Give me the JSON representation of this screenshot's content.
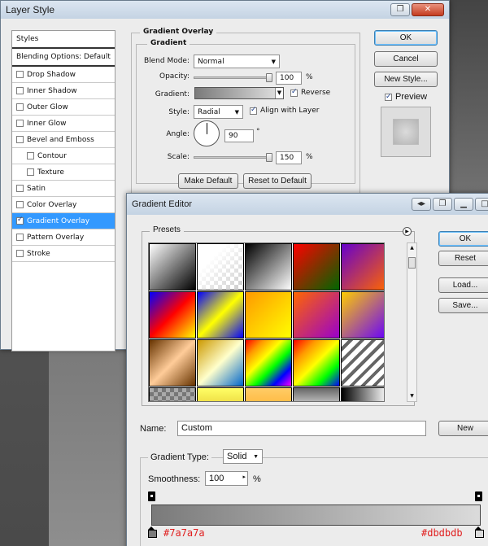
{
  "layer_style": {
    "title": "Layer Style",
    "styles_header": "Styles",
    "blending_options": "Blending Options: Default",
    "items": [
      {
        "label": "Drop Shadow",
        "checked": false,
        "sub": false,
        "active": false
      },
      {
        "label": "Inner Shadow",
        "checked": false,
        "sub": false,
        "active": false
      },
      {
        "label": "Outer Glow",
        "checked": false,
        "sub": false,
        "active": false
      },
      {
        "label": "Inner Glow",
        "checked": false,
        "sub": false,
        "active": false
      },
      {
        "label": "Bevel and Emboss",
        "checked": false,
        "sub": false,
        "active": false
      },
      {
        "label": "Contour",
        "checked": false,
        "sub": true,
        "active": false
      },
      {
        "label": "Texture",
        "checked": false,
        "sub": true,
        "active": false
      },
      {
        "label": "Satin",
        "checked": false,
        "sub": false,
        "active": false
      },
      {
        "label": "Color Overlay",
        "checked": false,
        "sub": false,
        "active": false
      },
      {
        "label": "Gradient Overlay",
        "checked": true,
        "sub": false,
        "active": true
      },
      {
        "label": "Pattern Overlay",
        "checked": false,
        "sub": false,
        "active": false
      },
      {
        "label": "Stroke",
        "checked": false,
        "sub": false,
        "active": false
      }
    ],
    "section_title": "Gradient Overlay",
    "group_title": "Gradient",
    "blend_mode_label": "Blend Mode:",
    "blend_mode_value": "Normal",
    "opacity_label": "Opacity:",
    "opacity_value": "100",
    "opacity_unit": "%",
    "opacity_level": 1.0,
    "gradient_label": "Gradient:",
    "reverse_label": "Reverse",
    "reverse_checked": true,
    "style_label": "Style:",
    "style_value": "Radial",
    "align_label": "Align with Layer",
    "align_checked": true,
    "angle_label": "Angle:",
    "angle_value": "90",
    "angle_unit": "°",
    "scale_label": "Scale:",
    "scale_value": "150",
    "scale_unit": "%",
    "scale_level": 1.0,
    "make_default": "Make Default",
    "reset_default": "Reset to Default",
    "ok": "OK",
    "cancel": "Cancel",
    "new_style": "New Style...",
    "preview_label": "Preview",
    "preview_checked": true
  },
  "gradient_editor": {
    "title": "Gradient Editor",
    "presets_label": "Presets",
    "ok": "OK",
    "reset": "Reset",
    "load": "Load...",
    "save": "Save...",
    "name_label": "Name:",
    "name_value": "Custom",
    "new": "New",
    "gradient_type_label": "Gradient Type:",
    "gradient_type_value": "Solid",
    "smoothness_label": "Smoothness:",
    "smoothness_value": "100",
    "smoothness_unit": "%",
    "left_stop_color": "#7a7a7a",
    "right_stop_color": "#dbdbdb",
    "left_stop_label": "#7a7a7a",
    "right_stop_label": "#dbdbdb"
  },
  "colors": {
    "selection_blue": "#3399ff",
    "stop_label_red": "#e02020"
  }
}
